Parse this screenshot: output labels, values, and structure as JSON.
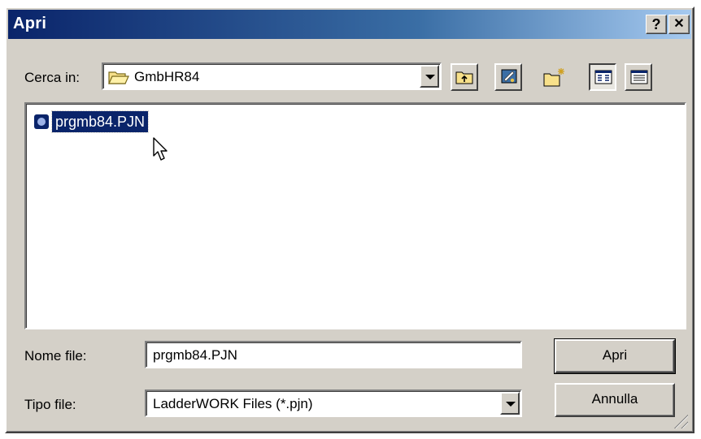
{
  "window": {
    "title": "Apri",
    "help_label": "?",
    "close_label": "✕"
  },
  "lookin": {
    "label": "Cerca in:",
    "value": "GmbHR84"
  },
  "toolbar": {
    "buttons": [
      {
        "name": "up-one-level",
        "icon": "folder-up-icon"
      },
      {
        "name": "desktop",
        "icon": "desktop-icon"
      },
      {
        "name": "new-folder",
        "icon": "new-folder-icon"
      },
      {
        "name": "list-view",
        "icon": "list-view-icon"
      },
      {
        "name": "details-view",
        "icon": "details-view-icon"
      }
    ]
  },
  "files": [
    {
      "name": "prgmb84.PJN",
      "selected": true
    }
  ],
  "filename": {
    "label": "Nome file:",
    "value": "prgmb84.PJN"
  },
  "filetype": {
    "label": "Tipo file:",
    "value": "LadderWORK Files (*.pjn)"
  },
  "buttons": {
    "open": "Apri",
    "cancel": "Annulla"
  },
  "colors": {
    "title_start": "#0a246a",
    "title_end": "#a6caf0",
    "selection": "#0a246a",
    "face": "#d4d0c8"
  }
}
